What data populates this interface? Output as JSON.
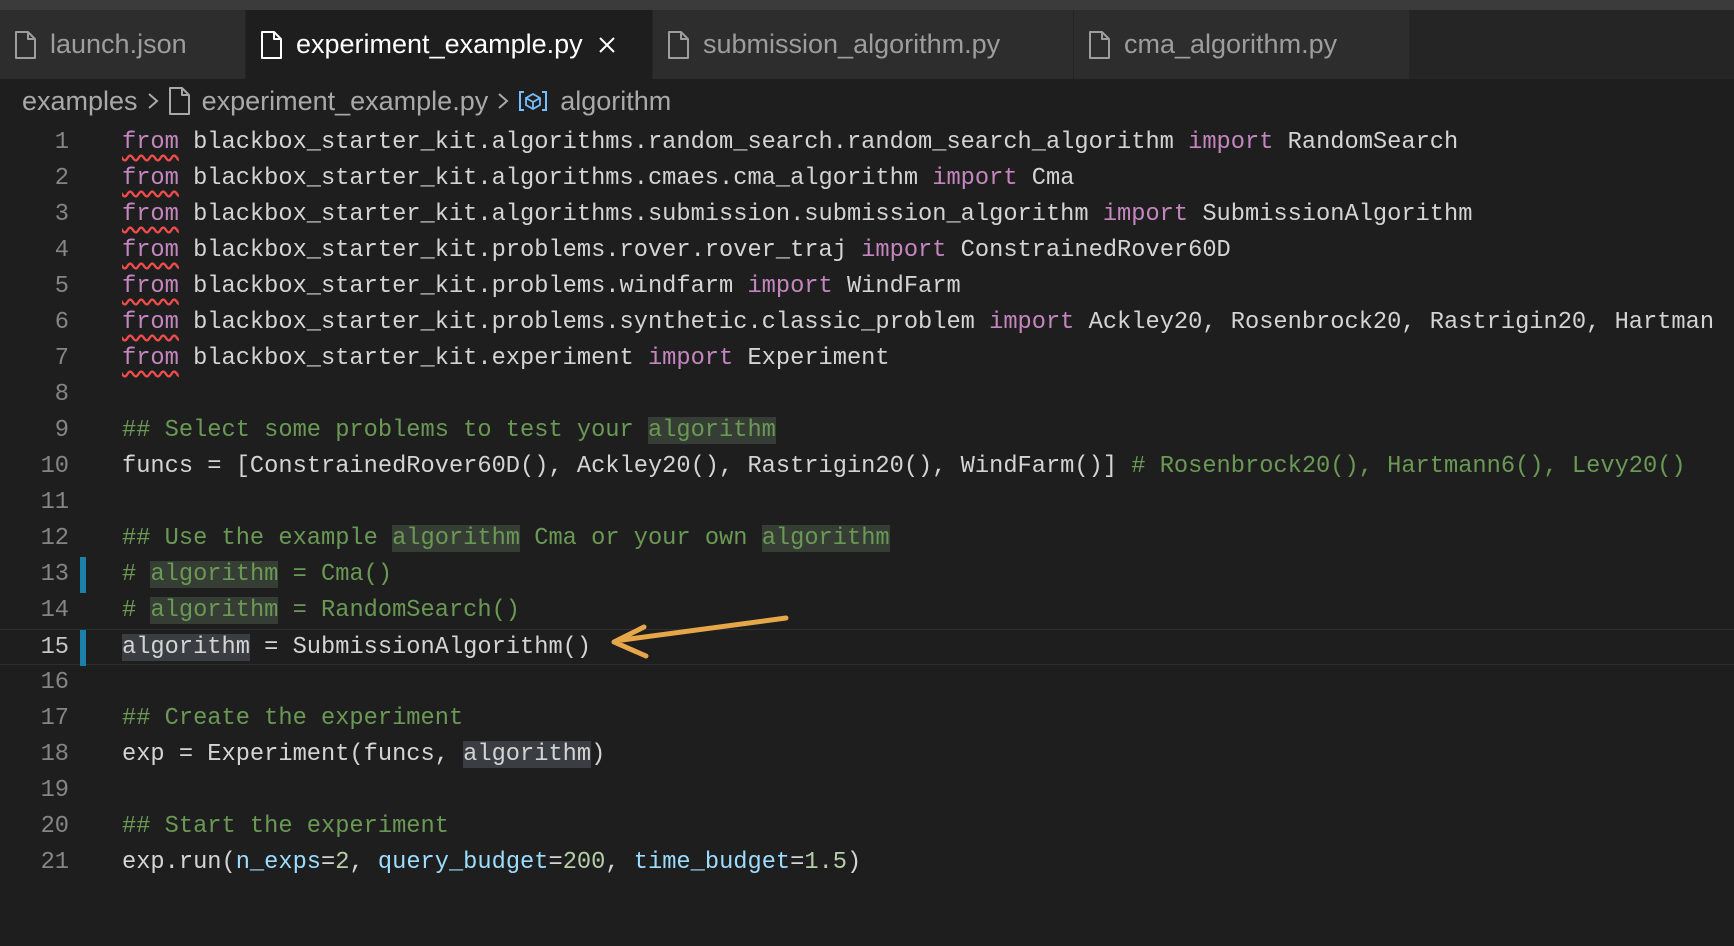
{
  "tabs": [
    {
      "label": "launch.json",
      "active": false
    },
    {
      "label": "experiment_example.py",
      "active": true
    },
    {
      "label": "submission_algorithm.py",
      "active": false
    },
    {
      "label": "cma_algorithm.py",
      "active": false
    }
  ],
  "breadcrumb": {
    "folder": "examples",
    "file": "experiment_example.py",
    "symbol": "algorithm"
  },
  "icons": {
    "file": "file-icon",
    "close": "close-icon",
    "chevron": "chevron-right-icon",
    "symbol": "symbol-variable-icon",
    "arrow": "arrow-annotation-icon"
  },
  "colors": {
    "keyword": "#c586c0",
    "comment": "#6a9955",
    "parameter": "#9cdcfe",
    "number": "#b5cea8",
    "modified_gutter": "#1b81a8",
    "arrow": "#e5a74a"
  },
  "editor": {
    "lines": [
      {
        "n": "1",
        "segs": [
          {
            "t": "from",
            "c": "from"
          },
          {
            "t": " blackbox_starter_kit.algorithms.random_search.random_search_algorithm "
          },
          {
            "t": "import",
            "c": "kw"
          },
          {
            "t": " RandomSearch"
          }
        ]
      },
      {
        "n": "2",
        "segs": [
          {
            "t": "from",
            "c": "from"
          },
          {
            "t": " blackbox_starter_kit.algorithms.cmaes.cma_algorithm "
          },
          {
            "t": "import",
            "c": "kw"
          },
          {
            "t": " Cma"
          }
        ]
      },
      {
        "n": "3",
        "segs": [
          {
            "t": "from",
            "c": "from"
          },
          {
            "t": " blackbox_starter_kit.algorithms.submission.submission_algorithm "
          },
          {
            "t": "import",
            "c": "kw"
          },
          {
            "t": " SubmissionAlgorithm"
          }
        ]
      },
      {
        "n": "4",
        "segs": [
          {
            "t": "from",
            "c": "from"
          },
          {
            "t": " blackbox_starter_kit.problems.rover.rover_traj "
          },
          {
            "t": "import",
            "c": "kw"
          },
          {
            "t": " ConstrainedRover60D"
          }
        ]
      },
      {
        "n": "5",
        "segs": [
          {
            "t": "from",
            "c": "from"
          },
          {
            "t": " blackbox_starter_kit.problems.windfarm "
          },
          {
            "t": "import",
            "c": "kw"
          },
          {
            "t": " WindFarm"
          }
        ]
      },
      {
        "n": "6",
        "segs": [
          {
            "t": "from",
            "c": "from"
          },
          {
            "t": " blackbox_starter_kit.problems.synthetic.classic_problem "
          },
          {
            "t": "import",
            "c": "kw"
          },
          {
            "t": " Ackley20, Rosenbrock20, Rastrigin20, Hartman"
          }
        ]
      },
      {
        "n": "7",
        "segs": [
          {
            "t": "from",
            "c": "from"
          },
          {
            "t": " blackbox_starter_kit.experiment "
          },
          {
            "t": "import",
            "c": "kw"
          },
          {
            "t": " Experiment"
          }
        ]
      },
      {
        "n": "8",
        "segs": []
      },
      {
        "n": "9",
        "segs": [
          {
            "t": "## Select some problems to test your ",
            "c": "cm"
          },
          {
            "t": "algorithm",
            "c": "cm hl"
          }
        ]
      },
      {
        "n": "10",
        "segs": [
          {
            "t": "funcs = [ConstrainedRover60D(), Ackley20(), Rastrigin20(), WindFarm()] "
          },
          {
            "t": "# Rosenbrock20(), Hartmann6(), Levy20()",
            "c": "cm"
          }
        ]
      },
      {
        "n": "11",
        "segs": []
      },
      {
        "n": "12",
        "segs": [
          {
            "t": "## Use the example ",
            "c": "cm"
          },
          {
            "t": "algorithm",
            "c": "cm hl"
          },
          {
            "t": " Cma or your own ",
            "c": "cm"
          },
          {
            "t": "algorithm",
            "c": "cm hl"
          }
        ]
      },
      {
        "n": "13",
        "mod": true,
        "segs": [
          {
            "t": "# ",
            "c": "cm"
          },
          {
            "t": "algorithm",
            "c": "cm hl"
          },
          {
            "t": " = Cma()",
            "c": "cm"
          }
        ]
      },
      {
        "n": "14",
        "segs": [
          {
            "t": "# ",
            "c": "cm"
          },
          {
            "t": "algorithm",
            "c": "cm hl"
          },
          {
            "t": " = RandomSearch()",
            "c": "cm"
          }
        ]
      },
      {
        "n": "15",
        "mod": true,
        "current": true,
        "segs": [
          {
            "t": "algorithm",
            "c": "hl-sel"
          },
          {
            "t": " = SubmissionAlgorithm()"
          }
        ]
      },
      {
        "n": "16",
        "segs": []
      },
      {
        "n": "17",
        "segs": [
          {
            "t": "## Create the experiment",
            "c": "cm"
          }
        ]
      },
      {
        "n": "18",
        "segs": [
          {
            "t": "exp = Experiment(funcs, "
          },
          {
            "t": "algorithm",
            "c": "hl-sel"
          },
          {
            "t": ")"
          }
        ]
      },
      {
        "n": "19",
        "segs": []
      },
      {
        "n": "20",
        "segs": [
          {
            "t": "## Start the experiment",
            "c": "cm"
          }
        ]
      },
      {
        "n": "21",
        "segs": [
          {
            "t": "exp.run("
          },
          {
            "t": "n_exps",
            "c": "par"
          },
          {
            "t": "="
          },
          {
            "t": "2",
            "c": "num"
          },
          {
            "t": ", "
          },
          {
            "t": "query_budget",
            "c": "par"
          },
          {
            "t": "="
          },
          {
            "t": "200",
            "c": "num"
          },
          {
            "t": ", "
          },
          {
            "t": "time_budget",
            "c": "par"
          },
          {
            "t": "="
          },
          {
            "t": "1.5",
            "c": "num"
          },
          {
            "t": ")"
          }
        ]
      }
    ]
  }
}
